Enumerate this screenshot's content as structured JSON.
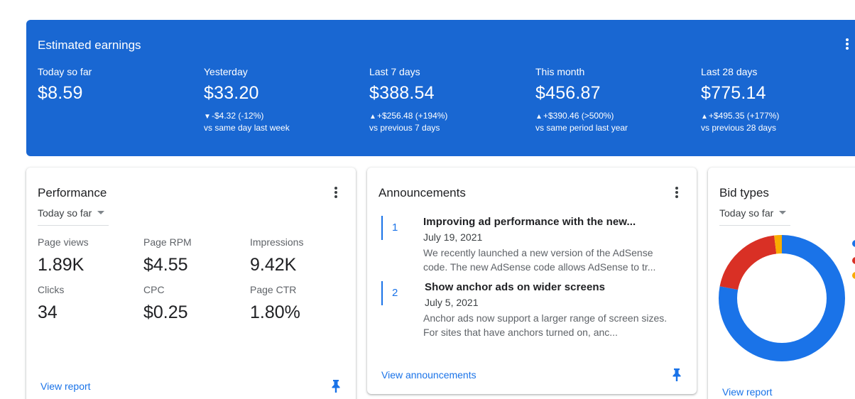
{
  "earnings": {
    "title": "Estimated earnings",
    "periods": [
      {
        "label": "Today so far",
        "value": "$8.59",
        "change": "",
        "compare": "",
        "direction": ""
      },
      {
        "label": "Yesterday",
        "value": "$33.20",
        "change": "-$4.32 (-12%)",
        "compare": "vs same day last week",
        "direction": "down"
      },
      {
        "label": "Last 7 days",
        "value": "$388.54",
        "change": "+$256.48 (+194%)",
        "compare": "vs previous 7 days",
        "direction": "up"
      },
      {
        "label": "This month",
        "value": "$456.87",
        "change": "+$390.46 (>500%)",
        "compare": "vs same period last year",
        "direction": "up"
      },
      {
        "label": "Last 28 days",
        "value": "$775.14",
        "change": "+$495.35 (+177%)",
        "compare": "vs previous 28 days",
        "direction": "up"
      }
    ],
    "up_symbol": "▲",
    "down_symbol": "▼"
  },
  "performance": {
    "title": "Performance",
    "range": "Today so far",
    "metrics": [
      {
        "label": "Page views",
        "value": "1.89K"
      },
      {
        "label": "Page RPM",
        "value": "$4.55"
      },
      {
        "label": "Impressions",
        "value": "9.42K"
      },
      {
        "label": "Clicks",
        "value": "34"
      },
      {
        "label": "CPC",
        "value": "$0.25"
      },
      {
        "label": "Page CTR",
        "value": "1.80%"
      }
    ],
    "link": "View report"
  },
  "announcements": {
    "title": "Announcements",
    "items": [
      {
        "num": "1",
        "headline": "Improving ad performance with the new...",
        "date": "July 19, 2021",
        "line1": "We recently launched a new version of the AdSense",
        "line2": "code. The new AdSense code allows AdSense to tr..."
      },
      {
        "num": "2",
        "headline": "Show anchor ads on wider screens",
        "date": "July 5, 2021",
        "line1": "Anchor ads now support a larger range of screen sizes.",
        "line2": "For sites that have anchors turned on, anc..."
      }
    ],
    "link": "View announcements"
  },
  "bid_types": {
    "title": "Bid types",
    "range": "Today so far",
    "link": "View report",
    "slices": [
      {
        "share": 0.78,
        "color": "#1a73e8"
      },
      {
        "share": 0.2,
        "color": "#d93025"
      },
      {
        "share": 0.02,
        "color": "#f9ab00"
      }
    ]
  },
  "colors": {
    "banner": "#1967d2",
    "accent": "#1a73e8"
  },
  "icons": {
    "menu": "more-vert-icon",
    "pin": "pin-icon",
    "caret": "caret-down-icon"
  }
}
